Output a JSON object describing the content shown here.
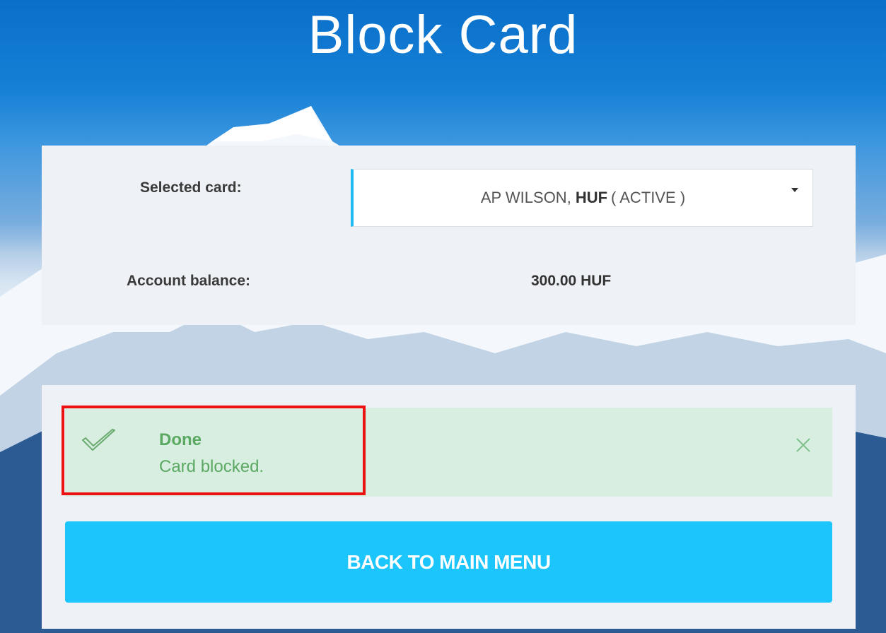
{
  "page": {
    "title": "Block Card"
  },
  "card_panel": {
    "selected_card_label": "Selected card:",
    "card_select": {
      "name": "AP WILSON,",
      "currency": "HUF",
      "status": "( ACTIVE )"
    },
    "account_balance_label": "Account balance:",
    "account_balance_value": "300.00 HUF"
  },
  "alert": {
    "title": "Done",
    "message": "Card blocked.",
    "icon": "check-icon",
    "close_icon": "close-icon",
    "color": "#5ba862",
    "background": "#d7eee0"
  },
  "actions": {
    "back_label": "BACK TO MAIN MENU"
  },
  "colors": {
    "accent": "#1cc5fc",
    "select_border": "#1fbbf5",
    "highlight": "#ee1111"
  }
}
